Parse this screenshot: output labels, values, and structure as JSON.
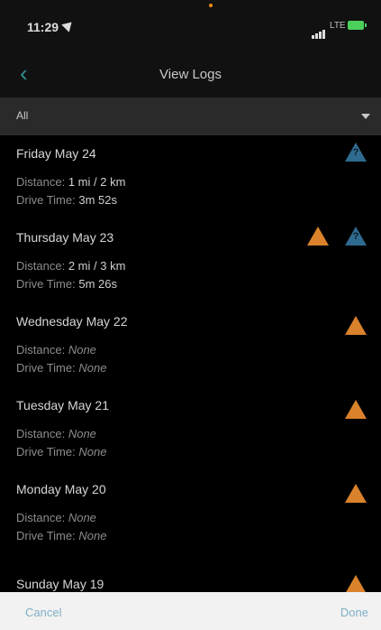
{
  "status": {
    "time": "11:29",
    "network": "LTE"
  },
  "nav": {
    "title": "View Logs",
    "back_glyph": "‹"
  },
  "filter": {
    "value": "All"
  },
  "entries": [
    {
      "date": "Friday May 24",
      "distance_label": "Distance:",
      "distance": "1 mi / 2 km",
      "drive_label": "Drive Time:",
      "drive": "3m 52s"
    },
    {
      "date": "Thursday May 23",
      "distance_label": "Distance:",
      "distance": "2 mi / 3 km",
      "drive_label": "Drive Time:",
      "drive": "5m 26s"
    },
    {
      "date": "Wednesday May 22",
      "distance_label": "Distance:",
      "distance": "None",
      "drive_label": "Drive Time:",
      "drive": "None"
    },
    {
      "date": "Tuesday May 21",
      "distance_label": "Distance:",
      "distance": "None",
      "drive_label": "Drive Time:",
      "drive": "None"
    },
    {
      "date": "Monday May 20",
      "distance_label": "Distance:",
      "distance": "None",
      "drive_label": "Drive Time:",
      "drive": "None"
    },
    {
      "date": "Sunday May 19"
    }
  ],
  "icon_marks": {
    "question": "?"
  },
  "toolbar": {
    "cancel": "Cancel",
    "done": "Done"
  },
  "colors": {
    "warning": "#d9822b",
    "info": "#2f6b8f",
    "accent": "#2f8f8a",
    "toolbar_text": "#7fb0c8"
  }
}
